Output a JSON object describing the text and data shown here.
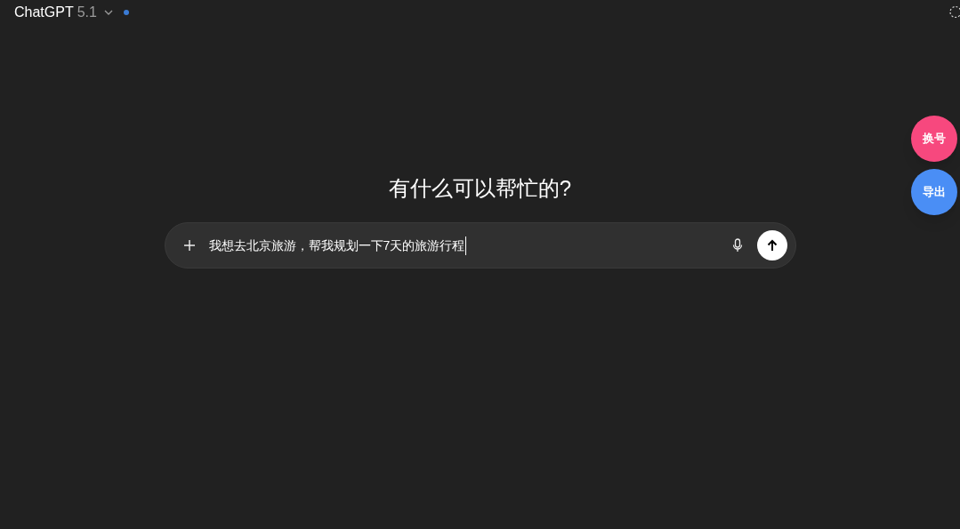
{
  "header": {
    "title": "ChatGPT",
    "version": "5.1",
    "status_dot": true
  },
  "heading": "有什么可以帮忙的?",
  "composer": {
    "value": "我想去北京旅游，帮我规划一下7天的旅游行程"
  },
  "side_buttons": [
    {
      "label": "换号",
      "color": "#f7487e"
    },
    {
      "label": "导出",
      "color": "#4a8ef5"
    }
  ]
}
